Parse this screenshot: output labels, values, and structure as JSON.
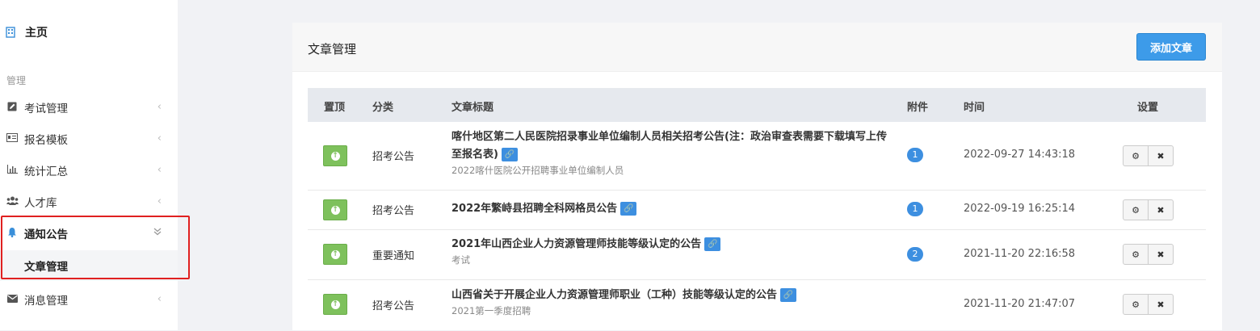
{
  "sidebar": {
    "home_label": "主页",
    "section_label": "管理",
    "items": [
      {
        "label": "考试管理",
        "icon": "edit-icon"
      },
      {
        "label": "报名模板",
        "icon": "id-card-icon"
      },
      {
        "label": "统计汇总",
        "icon": "bar-chart-icon"
      },
      {
        "label": "人才库",
        "icon": "users-icon"
      },
      {
        "label": "通知公告",
        "icon": "bell-icon"
      },
      {
        "label": "消息管理",
        "icon": "envelope-icon"
      }
    ],
    "sub_item": "文章管理"
  },
  "panel": {
    "title": "文章管理",
    "add_button": "添加文章"
  },
  "table": {
    "headers": {
      "pin": "置顶",
      "category": "分类",
      "title": "文章标题",
      "attachments": "附件",
      "time": "时间",
      "settings": "设置"
    },
    "rows": [
      {
        "category": "招考公告",
        "title": "喀什地区第二人民医院招录事业单位编制人员相关招考公告(注：政治审查表需要下载填写上传至报名表)",
        "subtitle": "2022喀什医院公开招聘事业单位编制人员",
        "attachments": "1",
        "time": "2022-09-27 14:43:18"
      },
      {
        "category": "招考公告",
        "title": "2022年繁峙县招聘全科网格员公告",
        "subtitle": "",
        "attachments": "1",
        "time": "2022-09-19 16:25:14"
      },
      {
        "category": "重要通知",
        "title": "2021年山西企业人力资源管理师技能等级认定的公告",
        "subtitle": "考试",
        "attachments": "2",
        "time": "2021-11-20 22:16:58"
      },
      {
        "category": "招考公告",
        "title": "山西省关于开展企业人力资源管理师职业（工种）技能等级认定的公告",
        "subtitle": "2021第一季度招聘",
        "attachments": "",
        "time": "2021-11-20 21:47:07"
      }
    ]
  },
  "colors": {
    "accent": "#3d9be9",
    "pin_green": "#7ec15c",
    "highlight_red": "#e02020"
  }
}
